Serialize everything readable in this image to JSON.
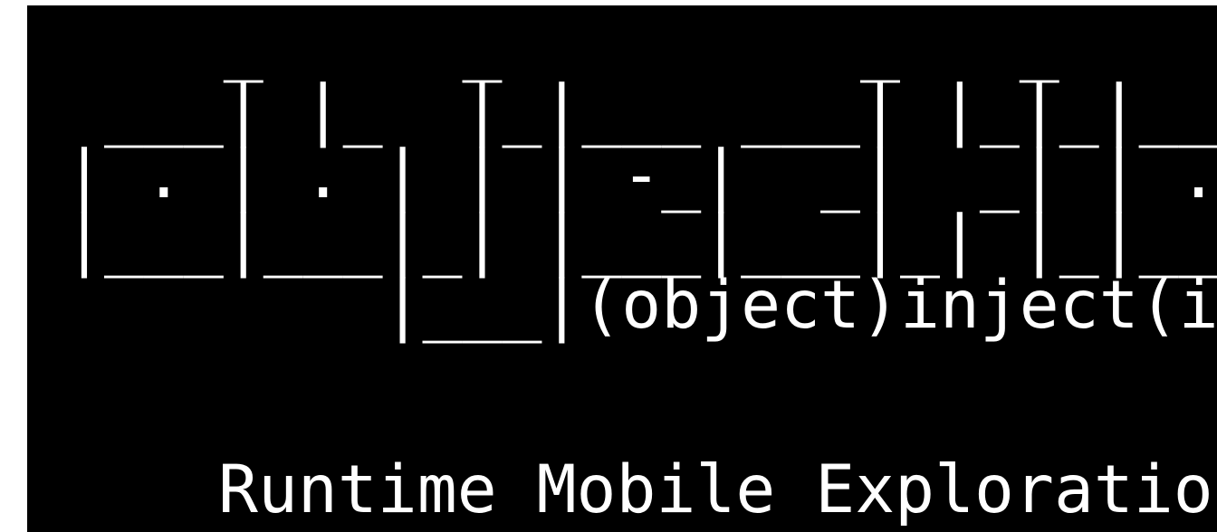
{
  "terminal": {
    "banner_lines": [
      "    _     _         _   _",
      " ___| |_  |_|___ ___| |_|_|___ ___",
      "| . | . | | | -_|  _|  _| | . |   |",
      "|___|___|_| |___|___|_| |_|___|_|_|",
      "        |___|(object)inject(ion)"
    ],
    "tagline": "Runtime Mobile Exploration",
    "background_color": "#000000",
    "text_color": "#ffffff"
  }
}
